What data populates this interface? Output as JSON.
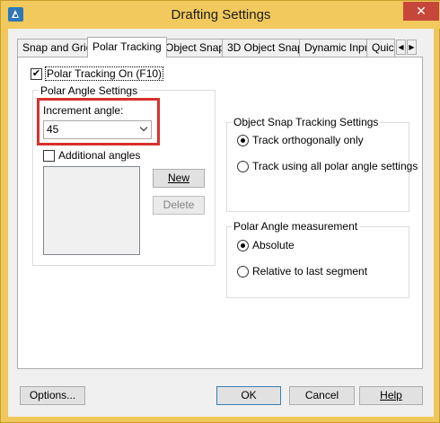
{
  "window": {
    "title": "Drafting Settings",
    "close_glyph": "✕",
    "app_icon": "autocad-a-icon"
  },
  "tabs": [
    {
      "label": "Snap and Grid",
      "active": false
    },
    {
      "label": "Polar Tracking",
      "active": true
    },
    {
      "label": "Object Snap",
      "active": false
    },
    {
      "label": "3D Object Snap",
      "active": false
    },
    {
      "label": "Dynamic Input",
      "active": false
    },
    {
      "label": "Quic",
      "active": false
    }
  ],
  "tab_scroll": {
    "left": "◀",
    "right": "▶"
  },
  "polar": {
    "tracking_on_label": "Polar Tracking On (F10)",
    "tracking_on_checked": true,
    "angle_group_title": "Polar Angle Settings",
    "increment_label": "Increment angle:",
    "increment_value": "45",
    "additional_label": "Additional angles",
    "additional_checked": false,
    "new_button": "New",
    "delete_button": "Delete"
  },
  "snap_tracking": {
    "group_title": "Object Snap Tracking Settings",
    "ortho_label": "Track orthogonally only",
    "all_label": "Track using all polar angle settings",
    "selected": "ortho"
  },
  "measurement": {
    "group_title": "Polar Angle measurement",
    "absolute_label": "Absolute",
    "relative_label": "Relative to last segment",
    "selected": "absolute"
  },
  "footer": {
    "options_button": "Options...",
    "ok_button": "OK",
    "cancel_button": "Cancel",
    "help_button": "Help"
  },
  "colors": {
    "titlebar": "#f2c95c",
    "highlight": "#d9302c",
    "close": "#c7463a"
  }
}
